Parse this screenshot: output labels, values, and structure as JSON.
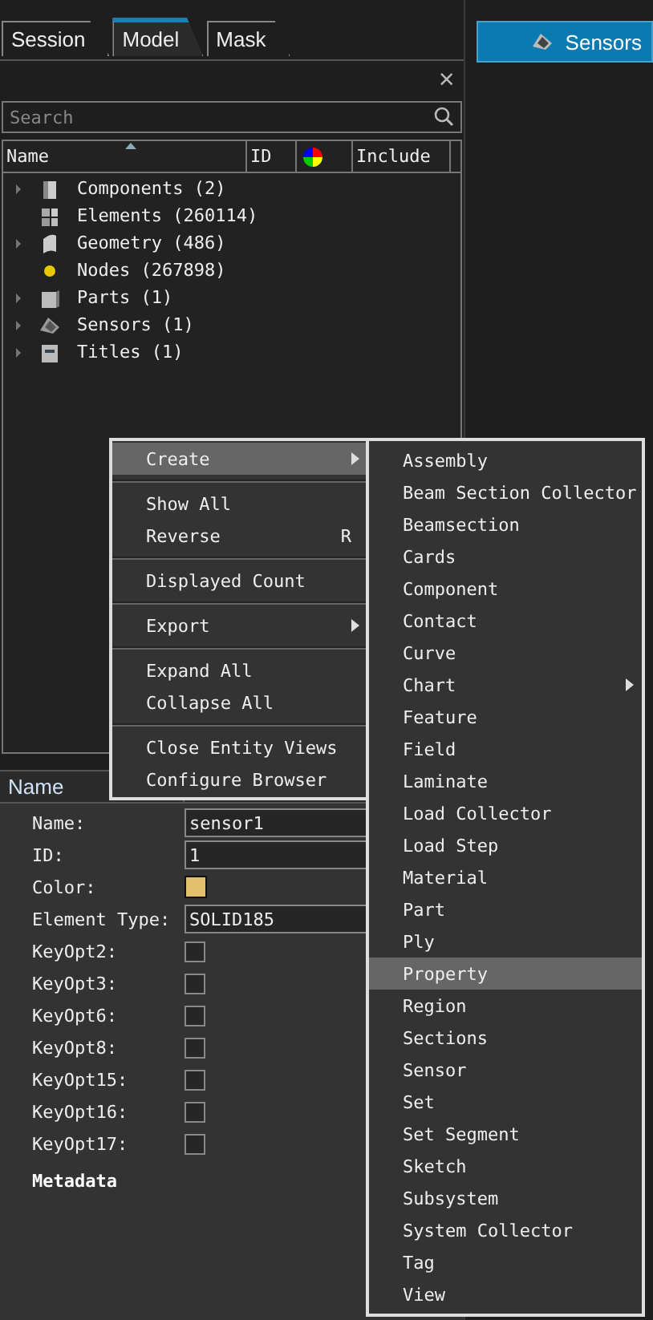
{
  "tabs": [
    {
      "label": "Session",
      "selected": false
    },
    {
      "label": "Model",
      "selected": true
    },
    {
      "label": "Mask",
      "selected": false
    }
  ],
  "close": "×",
  "search": {
    "placeholder": "Search"
  },
  "columns": [
    {
      "kind": "text",
      "label": "Name",
      "sorted": true
    },
    {
      "kind": "text",
      "label": "ID",
      "sorted": false
    },
    {
      "kind": "color",
      "sorted": false
    },
    {
      "kind": "text",
      "label": "Include",
      "sorted": false
    },
    {
      "kind": "blank",
      "sorted": false
    }
  ],
  "tree": [
    {
      "kind": "component",
      "label": "Components (2)",
      "expandable": true
    },
    {
      "kind": "element",
      "label": "Elements (260114)",
      "expandable": false
    },
    {
      "kind": "geometry",
      "label": "Geometry (486)",
      "expandable": true
    },
    {
      "kind": "node",
      "label": "Nodes (267898)",
      "expandable": false
    },
    {
      "kind": "part",
      "label": "Parts (1)",
      "expandable": true
    },
    {
      "kind": "sensor",
      "label": "Sensors (1)",
      "expandable": true
    },
    {
      "kind": "title",
      "label": "Titles (1)",
      "expandable": true
    }
  ],
  "sensors_button": {
    "label": "Sensors"
  },
  "properties": {
    "header": "Name",
    "rows": [
      {
        "kind": "text",
        "label": "Name:",
        "value": "sensor1"
      },
      {
        "kind": "text",
        "label": "ID:",
        "value": "1"
      },
      {
        "kind": "color",
        "label": "Color:",
        "color": "#e2c06e"
      },
      {
        "kind": "text",
        "label": "Element Type:",
        "value": "SOLID185"
      },
      {
        "kind": "checkbox",
        "label": "KeyOpt2:",
        "checked": false
      },
      {
        "kind": "checkbox",
        "label": "KeyOpt3:",
        "checked": false
      },
      {
        "kind": "checkbox",
        "label": "KeyOpt6:",
        "checked": false
      },
      {
        "kind": "checkbox",
        "label": "KeyOpt8:",
        "checked": false
      },
      {
        "kind": "checkbox",
        "label": "KeyOpt15:",
        "checked": false
      },
      {
        "kind": "checkbox",
        "label": "KeyOpt16:",
        "checked": false
      },
      {
        "kind": "checkbox",
        "label": "KeyOpt17:",
        "checked": false
      }
    ],
    "section": "Metadata"
  },
  "context_menu": [
    [
      {
        "label": "Create",
        "submenu": true,
        "selected": true
      }
    ],
    [
      {
        "label": "Show All",
        "submenu": false,
        "selected": false
      },
      {
        "label": "Reverse",
        "shortcut": "R",
        "submenu": false,
        "selected": false
      }
    ],
    [
      {
        "label": "Displayed Count",
        "submenu": false,
        "selected": false
      }
    ],
    [
      {
        "label": "Export",
        "submenu": true,
        "selected": false
      }
    ],
    [
      {
        "label": "Expand All",
        "submenu": false,
        "selected": false
      },
      {
        "label": "Collapse All",
        "submenu": false,
        "selected": false
      }
    ],
    [
      {
        "label": "Close Entity Views",
        "submenu": false,
        "selected": false
      },
      {
        "label": "Configure Browser",
        "submenu": false,
        "selected": false
      }
    ]
  ],
  "submenu": [
    {
      "label": "Assembly",
      "submenu": false,
      "selected": false
    },
    {
      "label": "Beam Section Collector",
      "submenu": false,
      "selected": false
    },
    {
      "label": "Beamsection",
      "submenu": false,
      "selected": false
    },
    {
      "label": "Cards",
      "submenu": false,
      "selected": false
    },
    {
      "label": "Component",
      "submenu": false,
      "selected": false
    },
    {
      "label": "Contact",
      "submenu": false,
      "selected": false
    },
    {
      "label": "Curve",
      "submenu": false,
      "selected": false
    },
    {
      "label": "Chart",
      "submenu": true,
      "selected": false
    },
    {
      "label": "Feature",
      "submenu": false,
      "selected": false
    },
    {
      "label": "Field",
      "submenu": false,
      "selected": false
    },
    {
      "label": "Laminate",
      "submenu": false,
      "selected": false
    },
    {
      "label": "Load Collector",
      "submenu": false,
      "selected": false
    },
    {
      "label": "Load Step",
      "submenu": false,
      "selected": false
    },
    {
      "label": "Material",
      "submenu": false,
      "selected": false
    },
    {
      "label": "Part",
      "submenu": false,
      "selected": false
    },
    {
      "label": "Ply",
      "submenu": false,
      "selected": false
    },
    {
      "label": "Property",
      "submenu": false,
      "selected": true
    },
    {
      "label": "Region",
      "submenu": false,
      "selected": false
    },
    {
      "label": "Sections",
      "submenu": false,
      "selected": false
    },
    {
      "label": "Sensor",
      "submenu": false,
      "selected": false
    },
    {
      "label": "Set",
      "submenu": false,
      "selected": false
    },
    {
      "label": "Set Segment",
      "submenu": false,
      "selected": false
    },
    {
      "label": "Sketch",
      "submenu": false,
      "selected": false
    },
    {
      "label": "Subsystem",
      "submenu": false,
      "selected": false
    },
    {
      "label": "System Collector",
      "submenu": false,
      "selected": false
    },
    {
      "label": "Tag",
      "submenu": false,
      "selected": false
    },
    {
      "label": "View",
      "submenu": false,
      "selected": false
    }
  ]
}
